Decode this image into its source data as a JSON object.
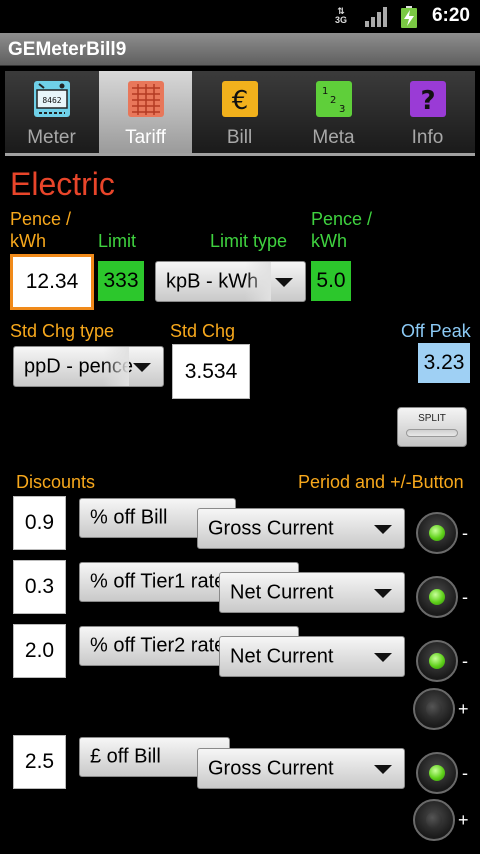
{
  "status": {
    "network": "3G",
    "time": "6:20"
  },
  "app": {
    "title": "GEMeterBill9"
  },
  "tabs": [
    {
      "label": "Meter",
      "icon": "meter-icon",
      "selected": false
    },
    {
      "label": "Tariff",
      "icon": "tariff-icon",
      "selected": true
    },
    {
      "label": "Bill",
      "icon": "euro-icon",
      "selected": false
    },
    {
      "label": "Meta",
      "icon": "meta-digits-icon",
      "selected": false
    },
    {
      "label": "Info",
      "icon": "question-icon",
      "selected": false
    }
  ],
  "section": {
    "heading": "Electric"
  },
  "rate": {
    "pence_label_1": "Pence /",
    "pence_label_2": "kWh",
    "value": "12.34",
    "limit_label": "Limit",
    "limit_value": "333",
    "limit_type_label": "Limit type",
    "limit_type_value": "kpB - kWh",
    "pence2_label_1": "Pence /",
    "pence2_label_2": "kWh",
    "pence2_value": "5.0"
  },
  "standing": {
    "type_label": "Std Chg type",
    "type_value": "ppD - pence",
    "chg_label": "Std Chg",
    "chg_value": "3.534",
    "offpeak_label": "Off Peak",
    "offpeak_value": "3.23",
    "split_label": "SPLIT"
  },
  "discounts": {
    "label": "Discounts",
    "period_label": "Period and +/-Button",
    "rows": [
      {
        "value": "0.9",
        "type": "% off Bill",
        "period": "Gross Current",
        "minus": "-"
      },
      {
        "value": "0.3",
        "type": "% off Tier1 rate",
        "period": "Net Current",
        "minus": "-"
      },
      {
        "value": "2.0",
        "type": "% off Tier2 rate",
        "period": "Net Current",
        "minus": "-"
      },
      {
        "value": "2.5",
        "type": "£ off Bill",
        "period": "Gross Current",
        "minus": "-"
      }
    ],
    "plus": "+"
  },
  "colors": {
    "heading": "#e8452a",
    "orange_label": "#f7a81c",
    "green_label": "#3fd23f",
    "blue_label": "#8ccaf5",
    "limit_fill": "#2cc72c",
    "offpeak_fill": "#9fd0f4",
    "focus_border": "#f08a1a"
  }
}
